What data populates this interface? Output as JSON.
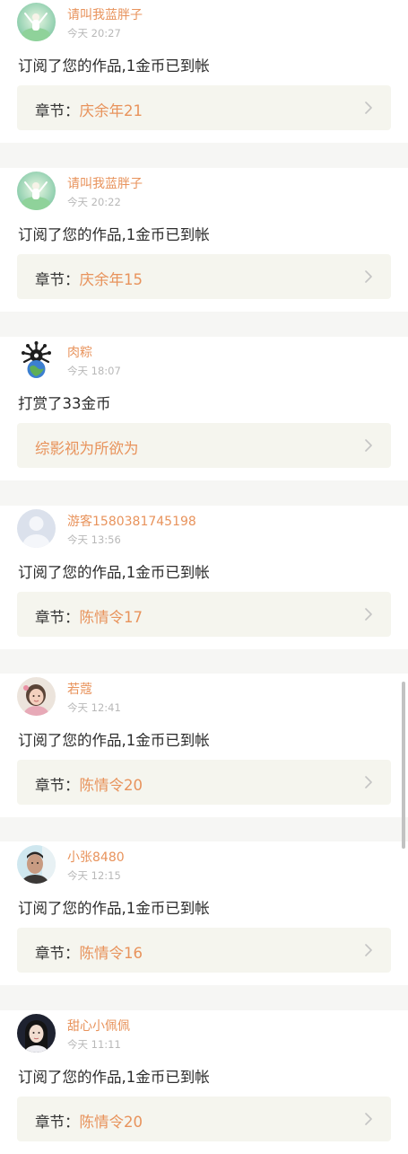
{
  "notifications": [
    {
      "user": "请叫我蓝胖子",
      "time": "今天 20:27",
      "message": "订阅了您的作品,1金币已到帐",
      "link_prefix": "章节：",
      "link_title": "庆余年21",
      "avatar": "green-nature-avatar"
    },
    {
      "user": "请叫我蓝胖子",
      "time": "今天 20:22",
      "message": "订阅了您的作品,1金币已到帐",
      "link_prefix": "章节：",
      "link_title": "庆余年15",
      "avatar": "green-nature-avatar"
    },
    {
      "user": "肉粽",
      "time": "今天 18:07",
      "message": "打赏了33金币",
      "link_prefix": "",
      "link_title": "综影视为所欲为",
      "avatar": "globe-emblem-avatar"
    },
    {
      "user": "游客1580381745198",
      "time": "今天 13:56",
      "message": "订阅了您的作品,1金币已到帐",
      "link_prefix": "章节：",
      "link_title": "陈情令17",
      "avatar": "default-guest-avatar"
    },
    {
      "user": "若蔻",
      "time": "今天 12:41",
      "message": "订阅了您的作品,1金币已到帐",
      "link_prefix": "章节：",
      "link_title": "陈情令20",
      "avatar": "child-photo-avatar"
    },
    {
      "user": "小张8480",
      "time": "今天 12:15",
      "message": "订阅了您的作品,1金币已到帐",
      "link_prefix": "章节：",
      "link_title": "陈情令16",
      "avatar": "man-photo-avatar"
    },
    {
      "user": "甜心小佩佩",
      "time": "今天 11:11",
      "message": "订阅了您的作品,1金币已到帐",
      "link_prefix": "章节：",
      "link_title": "陈情令20",
      "avatar": "girl-photo-avatar"
    }
  ],
  "colors": {
    "accent": "#e8935c",
    "background": "#f6f6f4",
    "link_background": "#f5f5ee",
    "text": "#2b2b2b",
    "muted": "#b8b8b8"
  }
}
